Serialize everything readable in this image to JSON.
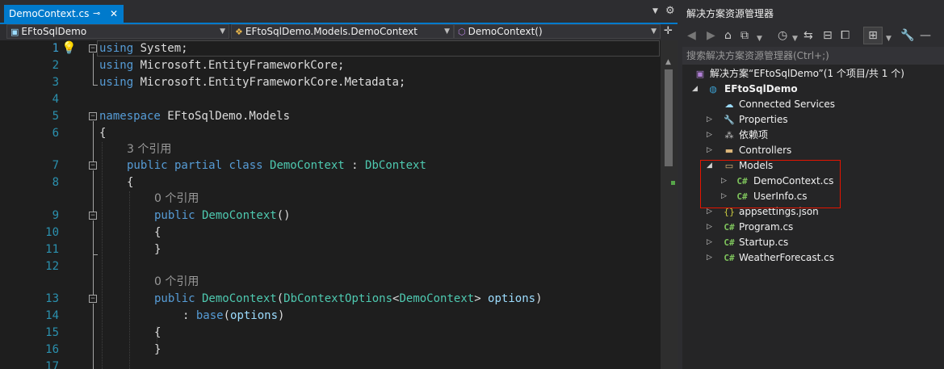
{
  "editor": {
    "tab": {
      "label": "DemoContext.cs",
      "pin": "⊸",
      "close": "✕"
    },
    "nav": {
      "project": "EFtoSqlDemo",
      "type": "EFtoSqlDemo.Models.DemoContext",
      "member": "DemoContext()"
    },
    "line_numbers": [
      "1",
      "2",
      "3",
      "4",
      "5",
      "6",
      "7",
      "8",
      "9",
      "10",
      "11",
      "12",
      "13",
      "14",
      "15",
      "16",
      "17"
    ],
    "lens": {
      "refs3": "3 个引用",
      "refs0a": "0 个引用",
      "refs0b": "0 个引用"
    },
    "code": {
      "l1_kw": "using",
      "l1_rest": " System;",
      "l2_kw": "using",
      "l2_rest": " Microsoft.EntityFrameworkCore;",
      "l3_kw": "using",
      "l3_rest": " Microsoft.EntityFrameworkCore.Metadata;",
      "l5_kw": "namespace",
      "l5_rest": " EFtoSqlDemo.Models",
      "l6": "{",
      "l7_kw1": "public",
      "l7_kw2": " partial",
      "l7_kw3": " class",
      "l7_t1": " DemoContext",
      "l7_sep": " :",
      "l7_t2": " DbContext",
      "l8": "{",
      "l9_kw": "public",
      "l9_t": " DemoContext",
      "l9_rest": "()",
      "l10": "{",
      "l11": "}",
      "l13_kw": "public",
      "l13_t1": " DemoContext",
      "l13_p": "(",
      "l13_t2": "DbContextOptions",
      "l13_lt": "<",
      "l13_t3": "DemoContext",
      "l13_gt": ">",
      "l13_id": " options",
      "l13_end": ")",
      "l14_pre": ": ",
      "l14_kw": "base",
      "l14_p": "(",
      "l14_id": "options",
      "l14_end": ")",
      "l15": "{",
      "l16": "}"
    }
  },
  "solution_explorer": {
    "title": "解决方案资源管理器",
    "search_placeholder": "搜索解决方案资源管理器(Ctrl+;)",
    "toolbar_icons": [
      "back-icon",
      "forward-icon",
      "home-icon",
      "switch-views-icon",
      "history-icon",
      "sync-icon",
      "collapse-all-icon",
      "show-all-files-icon",
      "properties-icon",
      "preview-icon"
    ],
    "solution_label": "解决方案“EFtoSqlDemo”(1 个项目/共 1 个)",
    "project": "EFtoSqlDemo",
    "items": [
      {
        "label": "Connected Services",
        "icon": "connected-services-icon"
      },
      {
        "label": "Properties",
        "icon": "wrench-icon"
      },
      {
        "label": "依赖项",
        "icon": "dependencies-icon"
      },
      {
        "label": "Controllers",
        "icon": "folder-icon"
      },
      {
        "label": "Models",
        "icon": "folder-open-icon"
      },
      {
        "label": "DemoContext.cs",
        "icon": "csharp-file-icon"
      },
      {
        "label": "UserInfo.cs",
        "icon": "csharp-file-icon"
      },
      {
        "label": "appsettings.json",
        "icon": "json-file-icon"
      },
      {
        "label": "Program.cs",
        "icon": "csharp-file-icon"
      },
      {
        "label": "Startup.cs",
        "icon": "csharp-file-icon"
      },
      {
        "label": "WeatherForecast.cs",
        "icon": "csharp-file-icon"
      }
    ],
    "csharp_glyph": "C#",
    "highlight_color": "#e51400"
  },
  "colors": {
    "accent": "#007acc",
    "keyword": "#569cd6",
    "type": "#4ec9b0",
    "identifier": "#9cdcfe",
    "line_number": "#2b91af"
  }
}
